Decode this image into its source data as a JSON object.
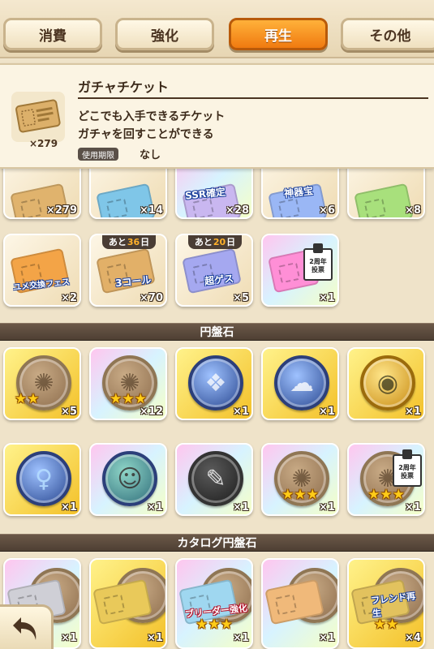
{
  "tabs": [
    {
      "label": "消費"
    },
    {
      "label": "強化"
    },
    {
      "label": "再生",
      "active": true
    },
    {
      "label": "その他"
    }
  ],
  "detail": {
    "title": "ガチャチケット",
    "description_line1": "どこでも入手できるチケット",
    "description_line2": "ガチャを回すことができる",
    "limit_label": "使用期限",
    "limit_value": "なし",
    "count": "×279"
  },
  "sections": {
    "discs": "円盤石",
    "catalog_discs": "カタログ円盤石"
  },
  "tickets_row1": [
    {
      "qty": "×279",
      "color": "#e0b36d"
    },
    {
      "qty": "×14",
      "color": "#7fc6e8"
    },
    {
      "qty": "×28",
      "color": "#c9b7f0",
      "art_text": "SSR確定"
    },
    {
      "qty": "×6",
      "color": "#9ab7f5",
      "art_text": "神器宝"
    },
    {
      "qty": "×8",
      "color": "#a8e07c"
    }
  ],
  "tickets_row2": [
    {
      "qty": "×2",
      "color": "#f3a447",
      "art_text": "ユメ交換フェス"
    },
    {
      "qty": "×70",
      "color": "#e2b068",
      "timer_prefix": "あと",
      "timer_days": "36",
      "timer_suffix": "日",
      "art_text": "3コール"
    },
    {
      "qty": "×5",
      "color": "#a5a8f0",
      "timer_prefix": "あと",
      "timer_days": "20",
      "timer_suffix": "日",
      "art_text": "超ゲス"
    },
    {
      "qty": "×1",
      "color": "#ff8fd6",
      "vote_text": "2周年 投票"
    }
  ],
  "discs_row1": [
    {
      "qty": "×5",
      "bg": "gold",
      "coin": "bronze",
      "stars": "★★"
    },
    {
      "qty": "×12",
      "bg": "rain",
      "coin": "bronze",
      "stars": "★★★"
    },
    {
      "qty": "×1",
      "bg": "gold",
      "coin": "blue",
      "stars": ""
    },
    {
      "qty": "×1",
      "bg": "gold",
      "coin": "blue",
      "stars": ""
    },
    {
      "qty": "×1",
      "bg": "gold",
      "coin": "gold",
      "stars": ""
    }
  ],
  "discs_row2": [
    {
      "qty": "×1",
      "bg": "gold",
      "coin": "blue",
      "stars": ""
    },
    {
      "qty": "×1",
      "bg": "rain",
      "coin": "blue",
      "stars": ""
    },
    {
      "qty": "×1",
      "bg": "rain",
      "coin": "dark",
      "stars": ""
    },
    {
      "qty": "×1",
      "bg": "rain",
      "coin": "bronze",
      "stars": "★★★"
    },
    {
      "qty": "×1",
      "bg": "rain",
      "coin": "bronze",
      "stars": "★★★",
      "vote_text": "2周年 投票"
    }
  ],
  "catalog_row": [
    {
      "qty": "×1",
      "bg": "rain"
    },
    {
      "qty": "×1",
      "bg": "gold"
    },
    {
      "qty": "×1",
      "bg": "rain",
      "art_text": "ブリーダー強化",
      "stars": "★★★"
    },
    {
      "qty": "×1",
      "bg": "rain"
    },
    {
      "qty": "×4",
      "bg": "gold",
      "art_text": "フレンド再生",
      "stars": "★★"
    }
  ],
  "icons": {
    "back": "back-arrow-icon"
  }
}
